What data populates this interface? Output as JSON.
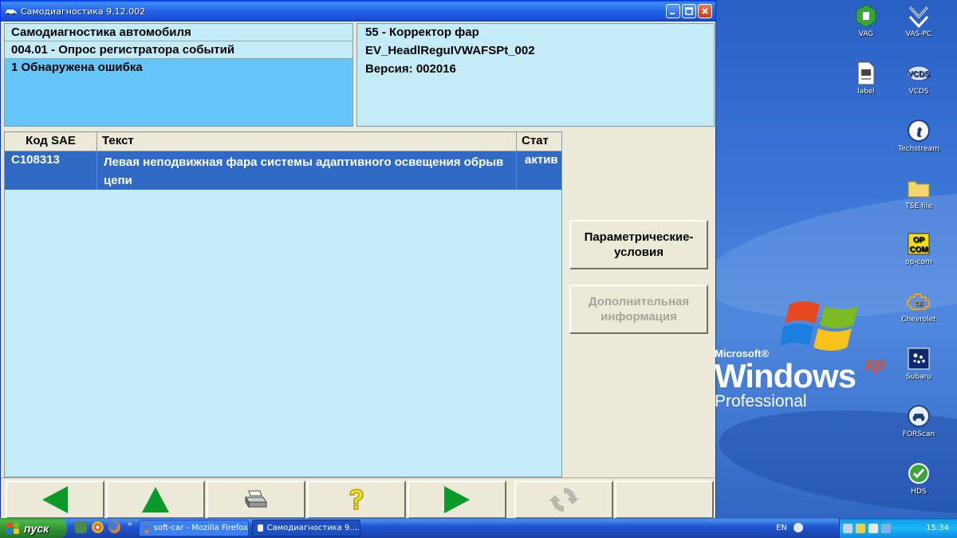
{
  "window": {
    "title": "Самодиагностика 9.12.002"
  },
  "left_info": {
    "line1": "Самодиагностика автомобиля",
    "line2": "004.01 - Опрос регистратора событий",
    "line3": "1 Обнаружена ошибка"
  },
  "right_info": {
    "line1": "55 - Корректор фар",
    "line2": "EV_HeadlReguIVWAFSPt_002",
    "line3": "Версия: 002016"
  },
  "table": {
    "headers": {
      "code": "Код SAE",
      "text": "Текст",
      "status": "Стат"
    },
    "rows": [
      {
        "code": "C108313",
        "text": "Левая неподвижная фара системы адаптивного освещения обрыв цепи",
        "status": "актив"
      }
    ]
  },
  "side_buttons": {
    "param_label": "Параметрические-\nусловия",
    "more_label": "Дополнительная информация"
  },
  "toolbar": {
    "icons": [
      "back-arrow-icon",
      "up-arrow-icon",
      "printer-icon",
      "help-icon",
      "forward-arrow-icon",
      "refresh-icon"
    ]
  },
  "desktop": {
    "icons": [
      {
        "label": "VAG"
      },
      {
        "label": "VAS-PC"
      },
      {
        "label": "label"
      },
      {
        "label": "VCDS"
      },
      {
        "label": "Techstream"
      },
      {
        "label": "TSE file"
      },
      {
        "label": "op-com"
      },
      {
        "label": "Chevrolet"
      },
      {
        "label": "Subaru"
      },
      {
        "label": "FORScan"
      },
      {
        "label": "HDS"
      }
    ],
    "logo": {
      "microsoft": "Microsoft®",
      "windows": "Windows",
      "xp": "xp",
      "edition": "Professional"
    }
  },
  "taskbar": {
    "start_label": "пуск",
    "tasks": [
      {
        "label": "soft-car - Mozilla Firefox"
      },
      {
        "label": "Самодиагностика 9...."
      }
    ],
    "lang": "EN",
    "clock": "15:34"
  },
  "colors": {
    "selection_blue": "#316ac5",
    "panel_cyan": "#c4ecf8",
    "highlight_cyan": "#66c6fa",
    "arrow_green": "#0a9a2a"
  }
}
